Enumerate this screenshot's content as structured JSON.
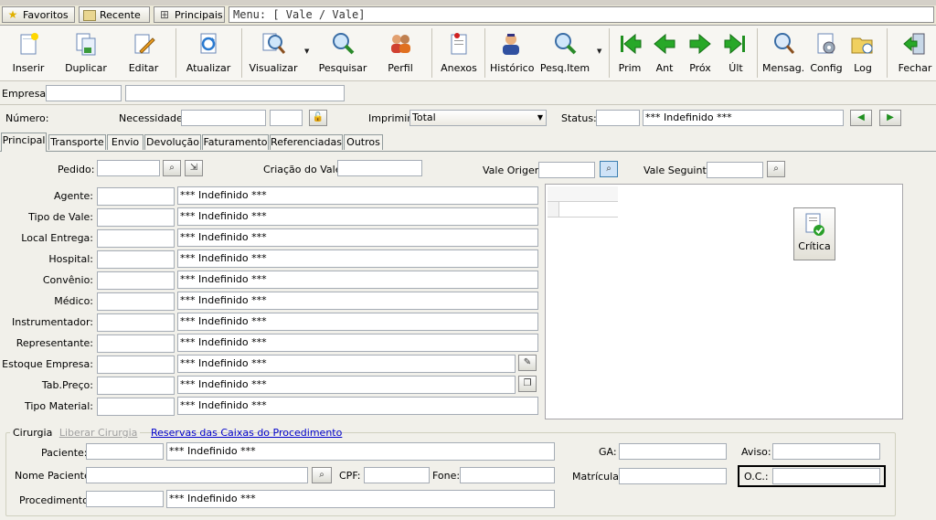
{
  "nav": {
    "favoritos": "Favoritos",
    "recente": "Recente",
    "principais": "Principais",
    "menu_path": "Menu: [ Vale / Vale]"
  },
  "toolbar": {
    "inserir": "Inserir",
    "duplicar": "Duplicar",
    "editar": "Editar",
    "atualizar": "Atualizar",
    "visualizar": "Visualizar",
    "pesquisar": "Pesquisar",
    "perfil": "Perfil",
    "anexos": "Anexos",
    "historico": "Histórico",
    "pesq_item": "Pesq.Item",
    "prim": "Prim",
    "ant": "Ant",
    "prox": "Próx",
    "ult": "Últ",
    "mensag": "Mensag.",
    "config": "Config",
    "log": "Log",
    "fechar": "Fechar"
  },
  "header": {
    "empresa_label": "Empresa:",
    "numero_label": "Número:",
    "necessidade_label": "Necessidade:",
    "imprimir_label": "Imprimir:",
    "imprimir_value": "Total",
    "status_label": "Status:",
    "status_desc": "*** Indefinido ***"
  },
  "tabs": [
    "Principal",
    "Transporte",
    "Envio",
    "Devolução",
    "Faturamento",
    "Referenciadas",
    "Outros"
  ],
  "principal": {
    "pedido_label": "Pedido:",
    "criacao_label": "Criação do Vale:",
    "vale_origem_label": "Vale Origem",
    "vale_seguinte_label": "Vale Seguinte",
    "critica_label": "Crítica",
    "fields": [
      {
        "label": "Agente:",
        "desc": "*** Indefinido ***"
      },
      {
        "label": "Tipo de Vale:",
        "desc": "*** Indefinido ***"
      },
      {
        "label": "Local Entrega:",
        "desc": "*** Indefinido ***"
      },
      {
        "label": "Hospital:",
        "desc": "*** Indefinido ***"
      },
      {
        "label": "Convênio:",
        "desc": "*** Indefinido ***"
      },
      {
        "label": "Médico:",
        "desc": "*** Indefinido ***"
      },
      {
        "label": "Instrumentador:",
        "desc": "*** Indefinido ***"
      },
      {
        "label": "Representante:",
        "desc": "*** Indefinido ***"
      },
      {
        "label": "Estoque Empresa:",
        "desc": "*** Indefinido ***"
      },
      {
        "label": "Tab.Preço:",
        "desc": "*** Indefinido ***"
      },
      {
        "label": "Tipo Material:",
        "desc": "*** Indefinido ***"
      }
    ]
  },
  "cirurgia": {
    "title": "Cirurgia",
    "liberar": "Liberar Cirurgia",
    "reservas": "Reservas das Caixas do Procedimento",
    "paciente_label": "Paciente:",
    "paciente_desc": "*** Indefinido ***",
    "nome_paciente_label": "Nome Paciente:",
    "cpf_label": "CPF:",
    "fone_label": "Fone:",
    "procedimento_label": "Procedimento:",
    "procedimento_desc": "*** Indefinido ***",
    "ga_label": "GA:",
    "aviso_label": "Aviso:",
    "matricula_label": "Matrícula:",
    "oc_label": "O.C.:"
  }
}
